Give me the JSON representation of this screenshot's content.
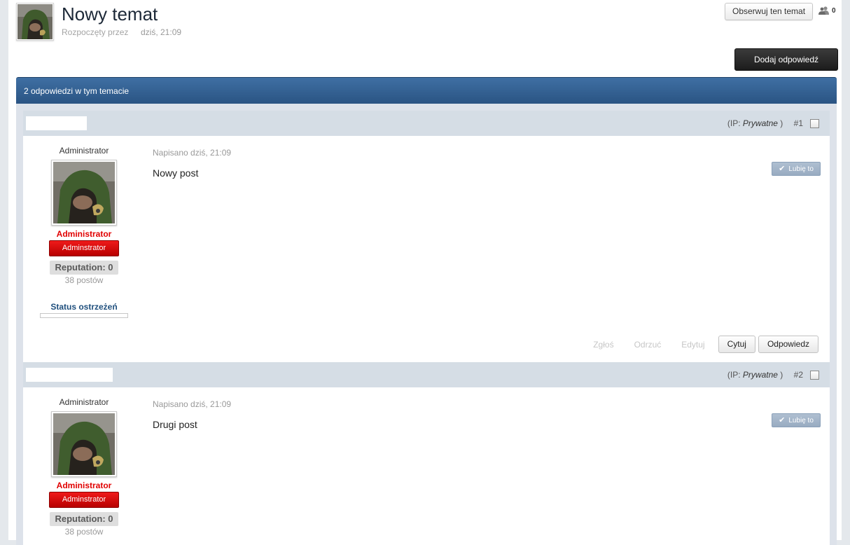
{
  "topic": {
    "title": "Nowy temat",
    "started_by": "Rozpoczęty przez",
    "date": "dziś, 21:09",
    "follow_label": "Obserwuj ten temat",
    "followers_count": "0",
    "add_reply_label": "Dodaj odpowiedź"
  },
  "maintitle": "2 odpowiedzi w tym temacie",
  "posts": [
    {
      "ip_prefix": "(IP:",
      "ip_value": "Prywatne",
      "ip_suffix": ")",
      "number": "#1",
      "group_top": "Administrator",
      "member_name": "Administrator",
      "rank": "Adminstrator",
      "reputation": "Reputation: 0",
      "post_count": "38 postów",
      "warn_label": "Status ostrzeżeń",
      "date": "Napisano dziś, 21:09",
      "body": "Nowy post",
      "like_label": "Lubię to",
      "actions": {
        "report": "Zgłoś",
        "reject": "Odrzuć",
        "edit": "Edytuj",
        "quote": "Cytuj",
        "reply": "Odpowiedz"
      }
    },
    {
      "ip_prefix": "(IP:",
      "ip_value": "Prywatne",
      "ip_suffix": ")",
      "number": "#2",
      "group_top": "Administrator",
      "member_name": "Administrator",
      "rank": "Adminstrator",
      "reputation": "Reputation: 0",
      "post_count": "38 postów",
      "date": "Napisano dziś, 21:09",
      "body": "Drugi post",
      "like_label": "Lubię to"
    }
  ],
  "colors": {
    "maintitle": "#2f5d8f",
    "member_name": "#e10000",
    "rank_badge": "#d40808",
    "like_button": "#a3b5c9"
  },
  "icons": {
    "followers": "users-icon",
    "like": "check-icon"
  }
}
